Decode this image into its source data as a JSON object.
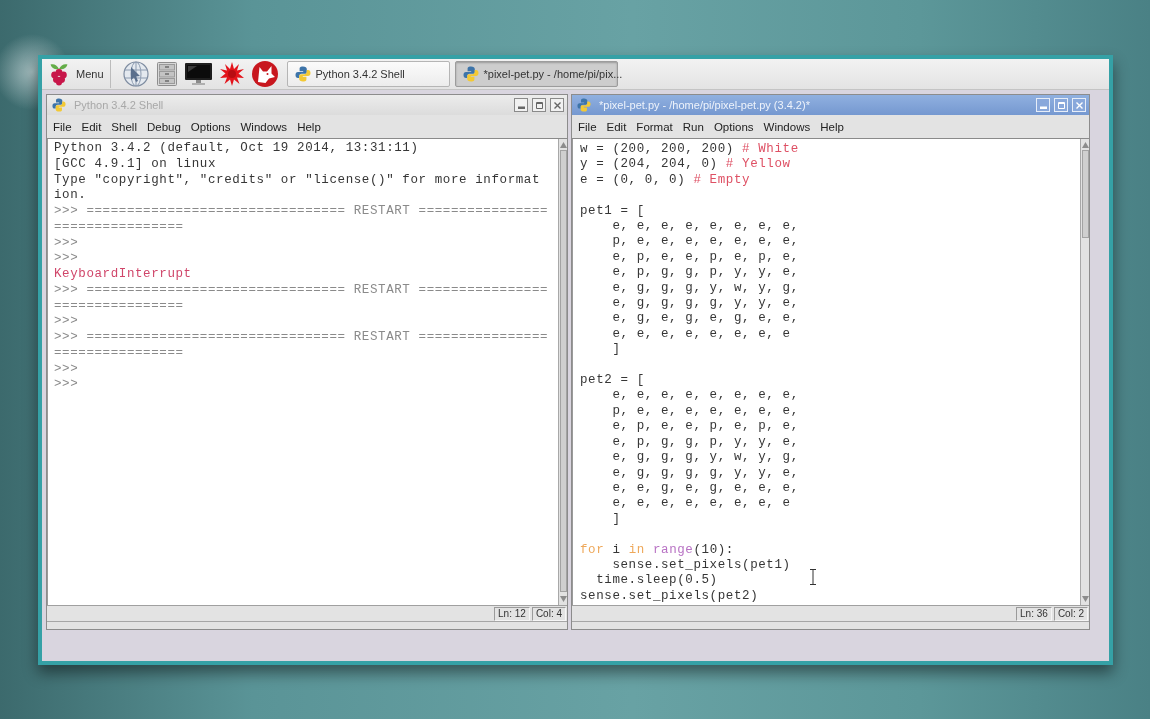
{
  "taskbar": {
    "menu_button": {
      "label": "Menu"
    },
    "tasks": [
      {
        "label": "Python 3.4.2 Shell",
        "selected": false
      },
      {
        "label": "*pixel-pet.py - /home/pi/pix...",
        "selected": true
      }
    ]
  },
  "windows": [
    {
      "kind": "shell",
      "title": "Python 3.4.2 Shell",
      "active": false,
      "menu": [
        "File",
        "Edit",
        "Shell",
        "Debug",
        "Options",
        "Windows",
        "Help"
      ],
      "blocks": [
        [
          [
            {
              "kind": "output",
              "text": "Python 3.4.2 (default, Oct 19 2014, 13:31:11)"
            }
          ],
          [
            {
              "kind": "output",
              "text": "[GCC 4.9.1] on linux"
            }
          ],
          [
            {
              "kind": "output",
              "text": "Type \"copyright\", \"credits\" or \"license()\" for more informat"
            }
          ],
          [
            {
              "kind": "output",
              "text": "ion."
            }
          ],
          [
            {
              "kind": "console",
              "text": ">>> ================================ RESTART ================"
            }
          ],
          [
            {
              "kind": "console",
              "text": "================"
            }
          ],
          [
            {
              "kind": "console",
              "text": ">>>"
            }
          ],
          [
            {
              "kind": "console",
              "text": ">>>"
            }
          ],
          [
            {
              "kind": "error",
              "text": "KeyboardInterrupt"
            }
          ],
          [
            {
              "kind": "console",
              "text": ">>> ================================ RESTART ================"
            }
          ],
          [
            {
              "kind": "console",
              "text": "================"
            }
          ],
          [
            {
              "kind": "console",
              "text": ">>>"
            }
          ],
          [
            {
              "kind": "console",
              "text": ">>> ================================ RESTART ================"
            }
          ],
          [
            {
              "kind": "console",
              "text": "================"
            }
          ],
          [
            {
              "kind": "console",
              "text": ">>>"
            }
          ],
          [
            {
              "kind": "console",
              "text": ">>>"
            }
          ]
        ]
      ],
      "status": {
        "line": "Ln: 12",
        "column": "Col: 4"
      }
    },
    {
      "kind": "editor",
      "title": "*pixel-pet.py - /home/pi/pixel-pet.py (3.4.2)*",
      "active": true,
      "menu": [
        "File",
        "Edit",
        "Format",
        "Run",
        "Options",
        "Windows",
        "Help"
      ],
      "blocks": [
        [
          [
            {
              "kind": "plain",
              "text": "w = (200, 200, 200) "
            },
            {
              "kind": "comment",
              "text": "# White"
            }
          ],
          [
            {
              "kind": "plain",
              "text": "y = (204, 204, 0) "
            },
            {
              "kind": "comment",
              "text": "# Yellow"
            }
          ],
          [
            {
              "kind": "plain",
              "text": "e = (0, 0, 0) "
            },
            {
              "kind": "comment",
              "text": "# Empty"
            }
          ]
        ],
        [
          [
            {
              "kind": "plain",
              "text": "pet1 = ["
            }
          ],
          [
            {
              "kind": "plain",
              "text": "    e, e, e, e, e, e, e, e,"
            }
          ],
          [
            {
              "kind": "plain",
              "text": "    p, e, e, e, e, e, e, e,"
            }
          ],
          [
            {
              "kind": "plain",
              "text": "    e, p, e, e, p, e, p, e,"
            }
          ],
          [
            {
              "kind": "plain",
              "text": "    e, p, g, g, p, y, y, e,"
            }
          ],
          [
            {
              "kind": "plain",
              "text": "    e, g, g, g, y, w, y, g,"
            }
          ],
          [
            {
              "kind": "plain",
              "text": "    e, g, g, g, g, y, y, e,"
            }
          ],
          [
            {
              "kind": "plain",
              "text": "    e, g, e, g, e, g, e, e,"
            }
          ],
          [
            {
              "kind": "plain",
              "text": "    e, e, e, e, e, e, e, e"
            }
          ],
          [
            {
              "kind": "plain",
              "text": "    ]"
            }
          ]
        ],
        [
          [
            {
              "kind": "plain",
              "text": "pet2 = ["
            }
          ],
          [
            {
              "kind": "plain",
              "text": "    e, e, e, e, e, e, e, e,"
            }
          ],
          [
            {
              "kind": "plain",
              "text": "    p, e, e, e, e, e, e, e,"
            }
          ],
          [
            {
              "kind": "plain",
              "text": "    e, p, e, e, p, e, p, e,"
            }
          ],
          [
            {
              "kind": "plain",
              "text": "    e, p, g, g, p, y, y, e,"
            }
          ],
          [
            {
              "kind": "plain",
              "text": "    e, g, g, g, y, w, y, g,"
            }
          ],
          [
            {
              "kind": "plain",
              "text": "    e, g, g, g, g, y, y, e,"
            }
          ],
          [
            {
              "kind": "plain",
              "text": "    e, e, g, e, g, e, e, e,"
            }
          ],
          [
            {
              "kind": "plain",
              "text": "    e, e, e, e, e, e, e, e"
            }
          ],
          [
            {
              "kind": "plain",
              "text": "    ]"
            }
          ]
        ],
        [
          [
            {
              "kind": "keyword",
              "text": "for"
            },
            {
              "kind": "plain",
              "text": " i "
            },
            {
              "kind": "keyword",
              "text": "in "
            },
            {
              "kind": "builtin",
              "text": "range"
            },
            {
              "kind": "plain",
              "text": "(10):"
            }
          ],
          [
            {
              "kind": "plain",
              "text": "    sense.set_pixels(pet1)"
            }
          ],
          [
            {
              "kind": "plain",
              "text": "  time.sleep(0.5)"
            }
          ],
          [
            {
              "kind": "plain",
              "text": "sense.set_pixels(pet2)"
            }
          ]
        ]
      ],
      "status": {
        "line": "Ln: 36",
        "column": "Col: 2"
      }
    }
  ]
}
